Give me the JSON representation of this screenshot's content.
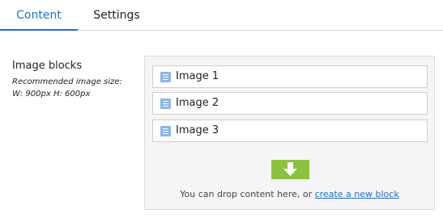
{
  "tabs": [
    {
      "label": "Content",
      "active": true
    },
    {
      "label": "Settings",
      "active": false
    }
  ],
  "field": {
    "label": "Image blocks",
    "hint_line1": "Recommended image size:",
    "hint_line2": "W: 900px H: 600px"
  },
  "blocks": [
    {
      "label": "Image 1",
      "icon": "block-icon"
    },
    {
      "label": "Image 2",
      "icon": "block-icon"
    },
    {
      "label": "Image 3",
      "icon": "block-icon"
    }
  ],
  "dropzone": {
    "icon": "down-arrow-icon",
    "text": "You can drop content here, or",
    "link": "create a new block"
  },
  "colors": {
    "accent": "#1f6fd1",
    "drop_arrow": "#8cc23f",
    "block_icon": "#8db5e8"
  }
}
